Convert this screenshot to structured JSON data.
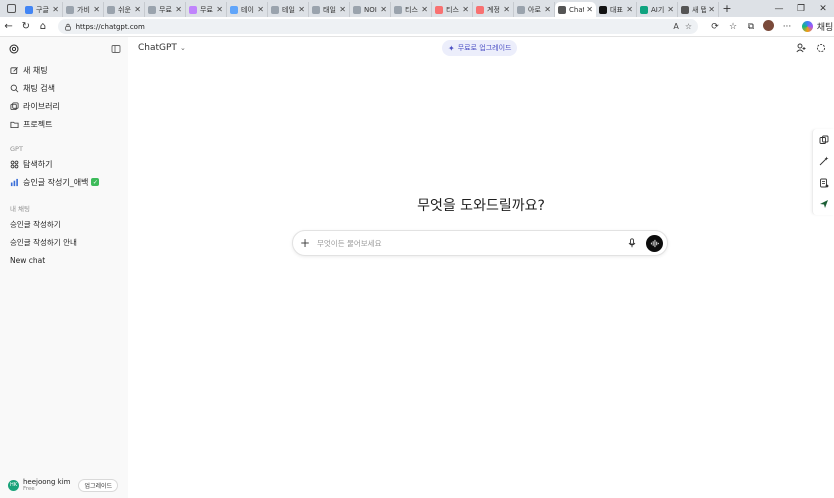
{
  "browser": {
    "tabs": [
      {
        "title": "구글",
        "color": "#4285f4"
      },
      {
        "title": "가비",
        "color": "#9aa3ad"
      },
      {
        "title": "쉬운",
        "color": "#9aa3ad"
      },
      {
        "title": "무료",
        "color": "#9aa3ad"
      },
      {
        "title": "무료",
        "color": "#c084fc"
      },
      {
        "title": "테이",
        "color": "#60a5fa"
      },
      {
        "title": "테일",
        "color": "#9aa3ad"
      },
      {
        "title": "태일",
        "color": "#9aa3ad"
      },
      {
        "title": "NOI",
        "color": "#9aa3ad"
      },
      {
        "title": "티스",
        "color": "#9aa3ad"
      },
      {
        "title": "티스",
        "color": "#f87171"
      },
      {
        "title": "계정",
        "color": "#f87171"
      },
      {
        "title": "아로",
        "color": "#9aa3ad"
      },
      {
        "title": "Chat",
        "color": "#555555",
        "active": true
      },
      {
        "title": "대표",
        "color": "#111111"
      },
      {
        "title": "AI기",
        "color": "#10a37f"
      },
      {
        "title": "새 탭",
        "color": "#555555"
      }
    ],
    "url": "https://chatgpt.com",
    "copilot_label": "채팅"
  },
  "sidebar": {
    "items": [
      {
        "label": "새 채팅",
        "icon": "edit-icon"
      },
      {
        "label": "채팅 검색",
        "icon": "search-icon"
      },
      {
        "label": "라이브러리",
        "icon": "library-icon"
      },
      {
        "label": "프로젝트",
        "icon": "folder-icon"
      }
    ],
    "gpt_section_label": "GPT",
    "gpt_items": [
      {
        "label": "탐색하기",
        "icon": "grid-icon"
      },
      {
        "label": "승인글 작성기_애백",
        "icon": "chart-icon"
      }
    ],
    "chats_section_label": "내 채팅",
    "chats": [
      {
        "label": "승인글 작성하기"
      },
      {
        "label": "승인글 작성하기 안내"
      },
      {
        "label": "New chat"
      }
    ],
    "user": {
      "initials": "HK",
      "name": "heejoong kim",
      "plan": "Free",
      "upgrade_label": "업그레이드"
    }
  },
  "main": {
    "model_label": "ChatGPT",
    "upgrade_pill": "무료로 업그레이드",
    "hero_text": "무엇을 도와드릴까요?",
    "composer_placeholder": "무엇이든 물어보세요"
  },
  "colors": {
    "accent_pill_bg": "#eceefb",
    "accent_pill_text": "#4b4fc4",
    "check_green": "#3dbb5a"
  }
}
